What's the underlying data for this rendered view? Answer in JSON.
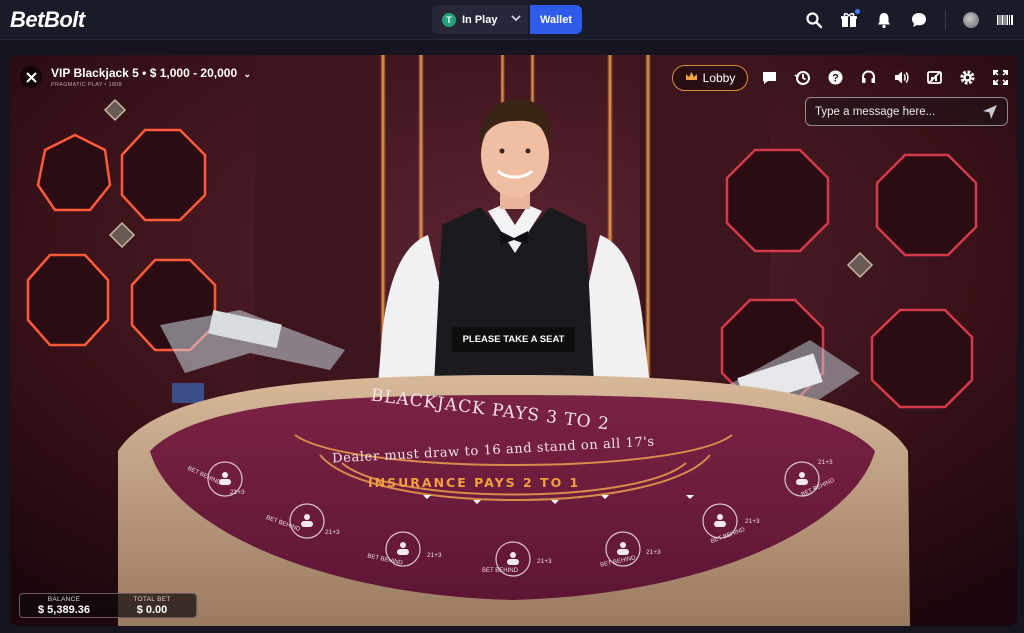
{
  "app": {
    "logo": "BetBolt"
  },
  "header": {
    "in_play_label": "In Play",
    "currency_symbol": "T",
    "wallet_label": "Wallet"
  },
  "game": {
    "title": "VIP Blackjack 5 • $ 1,000 - 20,000",
    "provider": "PRAGMATIC PLAY • 1808",
    "lobby_label": "Lobby",
    "chat_placeholder": "Type a message here...",
    "seat_message": "PLEASE TAKE A SEAT",
    "table_text": {
      "main": "BLACKJACK PAYS 3 TO 2",
      "rule": "Dealer must draw to 16 and stand on all 17's",
      "insurance": "INSURANCE PAYS 2 TO 1",
      "bet_behind": "BET BEHIND",
      "side_bet": "21+3"
    },
    "balance_label": "BALANCE",
    "balance_value": "$ 5,389.36",
    "total_bet_label": "TOTAL BET",
    "total_bet_value": "$ 0.00"
  },
  "colors": {
    "wallet_button": "#2f5bea",
    "lobby_border": "#d98c3c",
    "felt": "#6d1c3a",
    "gold_text": "#f0a040"
  },
  "icons": {
    "top": [
      "search-icon",
      "gift-icon",
      "bell-icon",
      "chat-icon",
      "avatar",
      "barcode-icon"
    ],
    "controls": [
      "chat-icon",
      "history-icon",
      "help-icon",
      "support-icon",
      "sound-icon",
      "video-icon",
      "settings-icon",
      "fullscreen-icon"
    ]
  }
}
